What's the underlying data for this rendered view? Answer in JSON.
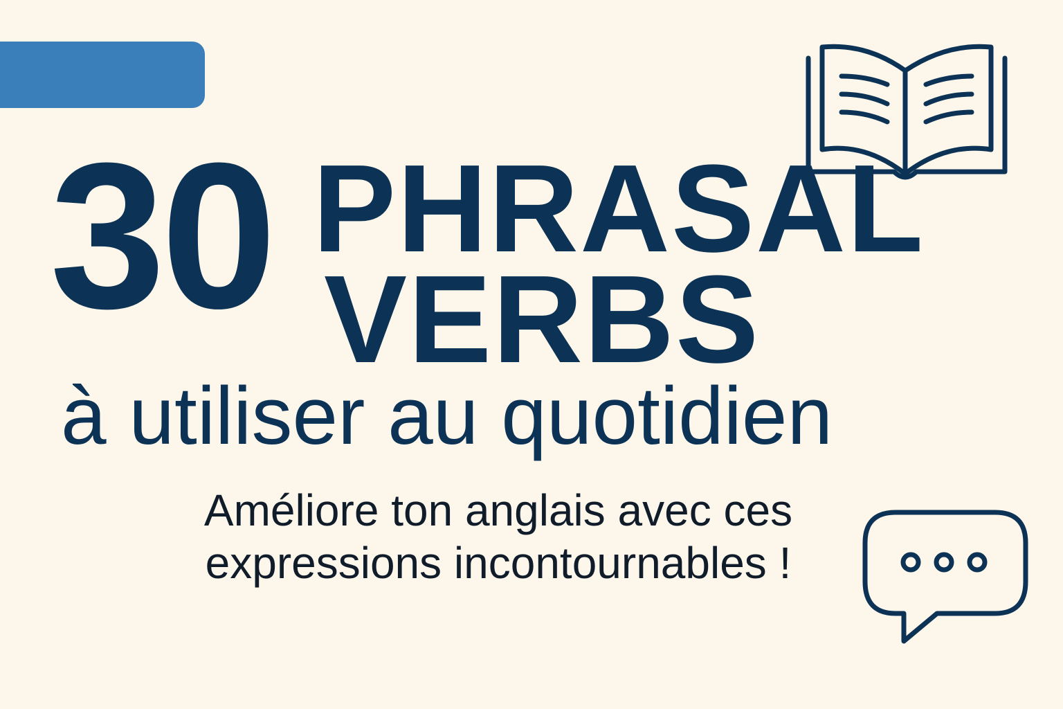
{
  "headline": {
    "number": "30",
    "line1": "PHRASAL",
    "line2": "VERBS"
  },
  "subtitle": "à utiliser au quotidien",
  "tagline": {
    "line1": "Améliore ton anglais avec ces",
    "line2": "expressions incontournables !"
  },
  "icons": {
    "top_right": "open-book-icon",
    "bottom_right": "speech-bubble-icon"
  },
  "colors": {
    "background": "#fdf6ea",
    "primary": "#0c3355",
    "accent": "#3a7eba"
  }
}
